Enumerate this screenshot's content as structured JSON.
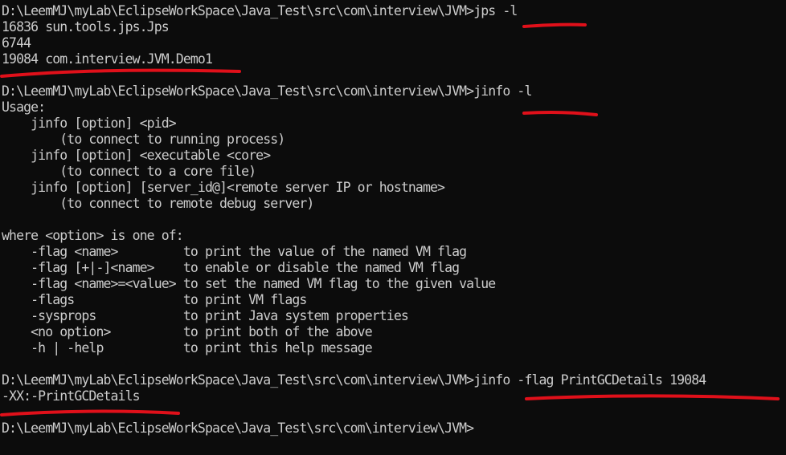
{
  "terminal": {
    "annotation_color": "#e0101a",
    "lines": [
      {
        "prompt": "D:\\LeemMJ\\myLab\\EclipseWorkSpace\\Java_Test\\src\\com\\interview\\JVM>",
        "cmd": "jps -l"
      },
      {
        "text": "16836 sun.tools.jps.Jps"
      },
      {
        "text": "6744"
      },
      {
        "text": "19084 com.interview.JVM.Demo1"
      },
      {
        "text": ""
      },
      {
        "prompt": "D:\\LeemMJ\\myLab\\EclipseWorkSpace\\Java_Test\\src\\com\\interview\\JVM>",
        "cmd": "jinfo -l"
      },
      {
        "text": "Usage:"
      },
      {
        "text": "    jinfo [option] <pid>"
      },
      {
        "text": "        (to connect to running process)"
      },
      {
        "text": "    jinfo [option] <executable <core>"
      },
      {
        "text": "        (to connect to a core file)"
      },
      {
        "text": "    jinfo [option] [server_id@]<remote server IP or hostname>"
      },
      {
        "text": "        (to connect to remote debug server)"
      },
      {
        "text": ""
      },
      {
        "text": "where <option> is one of:"
      },
      {
        "text": "    -flag <name>         to print the value of the named VM flag"
      },
      {
        "text": "    -flag [+|-]<name>    to enable or disable the named VM flag"
      },
      {
        "text": "    -flag <name>=<value> to set the named VM flag to the given value"
      },
      {
        "text": "    -flags               to print VM flags"
      },
      {
        "text": "    -sysprops            to print Java system properties"
      },
      {
        "text": "    <no option>          to print both of the above"
      },
      {
        "text": "    -h | -help           to print this help message"
      },
      {
        "text": ""
      },
      {
        "prompt": "D:\\LeemMJ\\myLab\\EclipseWorkSpace\\Java_Test\\src\\com\\interview\\JVM>",
        "cmd": "jinfo -flag PrintGCDetails 19084"
      },
      {
        "text": "-XX:-PrintGCDetails"
      },
      {
        "text": ""
      },
      {
        "prompt": "D:\\LeemMJ\\myLab\\EclipseWorkSpace\\Java_Test\\src\\com\\interview\\JVM>",
        "cmd": ""
      }
    ]
  }
}
